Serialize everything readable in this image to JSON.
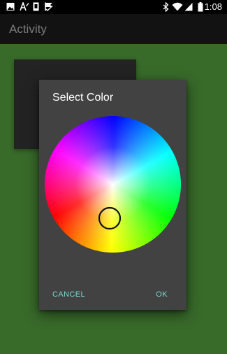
{
  "status_bar": {
    "time": "1:08",
    "icons": [
      "image-icon",
      "font-size-icon",
      "sd-card-icon",
      "flag-check-icon",
      "bluetooth-icon",
      "wifi-icon",
      "signal-icon",
      "battery-icon"
    ]
  },
  "app_bar": {
    "title": "Activity"
  },
  "dialog": {
    "title": "Select Color",
    "cancel_label": "CANCEL",
    "ok_label": "OK"
  },
  "colors": {
    "background": "#386a2a",
    "app_bar": "#121212",
    "dialog": "#424242",
    "button_text": "#7fd4d0"
  }
}
